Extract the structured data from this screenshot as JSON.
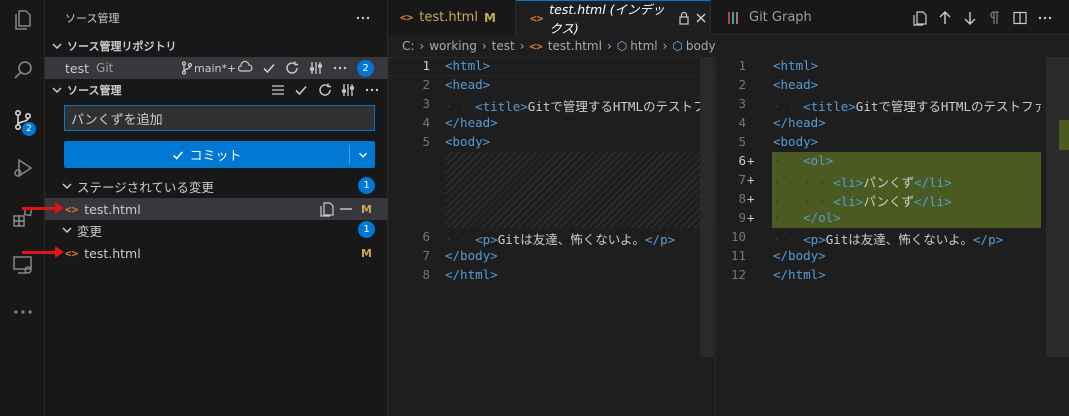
{
  "sidebar": {
    "title": "ソース管理",
    "repo_section": "ソース管理リポジトリ",
    "repo_name": "test",
    "repo_type": "Git",
    "branch": "main*+",
    "repo_badge": "2",
    "sc_section": "ソース管理",
    "commit_message": "パンくずを追加",
    "commit_button": "コミット",
    "staged_section": "ステージされている変更",
    "staged_count": "1",
    "staged_file": "test.html",
    "staged_status": "M",
    "changes_section": "変更",
    "changes_count": "1",
    "changes_file": "test.html",
    "changes_status": "M"
  },
  "activity": {
    "scm_badge": "2"
  },
  "tabs": [
    {
      "label": "test.html",
      "status": "M"
    },
    {
      "label": "test.html (インデックス)"
    },
    {
      "label": "Git Graph"
    }
  ],
  "breadcrumb": {
    "drive": "C:",
    "folder1": "working",
    "folder2": "test",
    "file": "test.html",
    "sym1": "html",
    "sym2": "body"
  },
  "left_editor": {
    "lines": [
      {
        "n": "1",
        "t": "<html>"
      },
      {
        "n": "2",
        "t": "<head>"
      },
      {
        "n": "3",
        "t": "<title>Gitで管理するHTMLのテストファ"
      },
      {
        "n": "4",
        "t": "</head>"
      },
      {
        "n": "5",
        "t": "<body>"
      },
      {
        "n": "6",
        "t": "<p>Gitは友達、怖くないよ。</p>"
      },
      {
        "n": "7",
        "t": "</body>"
      },
      {
        "n": "8",
        "t": "</html>"
      }
    ]
  },
  "right_editor": {
    "lines": [
      {
        "n": "1",
        "t": "<html>"
      },
      {
        "n": "2",
        "t": "<head>"
      },
      {
        "n": "3",
        "t": "<title>Gitで管理するHTMLのテストファ"
      },
      {
        "n": "4",
        "t": "</head>"
      },
      {
        "n": "5",
        "t": "<body>"
      },
      {
        "n": "6",
        "t": "<ol>"
      },
      {
        "n": "7",
        "t": "<li>パンくず</li>"
      },
      {
        "n": "8",
        "t": "<li>パンくず</li>"
      },
      {
        "n": "9",
        "t": "</ol>"
      },
      {
        "n": "10",
        "t": "<p>Gitは友達、怖くないよ。</p>"
      },
      {
        "n": "11",
        "t": "</body>"
      },
      {
        "n": "12",
        "t": "</html>"
      }
    ],
    "added_marker": "+"
  },
  "colors": {
    "accent": "#0078d4",
    "added_bg": "#4b5a20",
    "html_icon": "#e37933",
    "annotation_arrow": "#e01414"
  }
}
